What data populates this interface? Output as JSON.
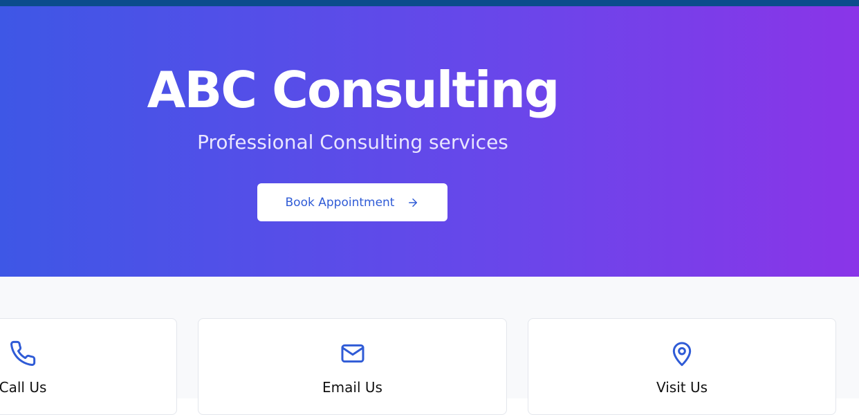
{
  "hero": {
    "title": "ABC Consulting",
    "subtitle": "Professional Consulting services",
    "cta_label": "Book Appointment",
    "cta_icon": "arrow-right-icon",
    "gradient_start": "#3e57e6",
    "gradient_end": "#8a35e8"
  },
  "contact_cards": [
    {
      "label": "Call Us",
      "icon": "phone-icon"
    },
    {
      "label": "Email Us",
      "icon": "mail-icon"
    },
    {
      "label": "Visit Us",
      "icon": "map-pin-icon"
    }
  ],
  "colors": {
    "topbar": "#0b4c8c",
    "accent": "#2f5bd6",
    "section_bg": "#f8f9fb"
  }
}
